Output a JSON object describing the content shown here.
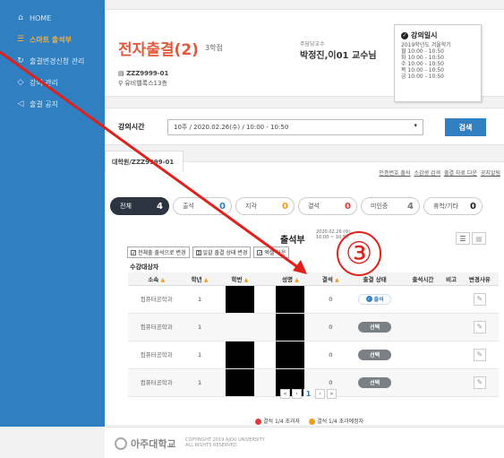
{
  "sidebar": {
    "items": [
      {
        "label": "HOME",
        "icon": "home-icon"
      },
      {
        "label": "스마트 출석부",
        "icon": "list-icon",
        "active": true
      },
      {
        "label": "출결변경신청 관리",
        "icon": "refresh-icon"
      },
      {
        "label": "강의 관리",
        "icon": "book-icon"
      },
      {
        "label": "출결 공지",
        "icon": "speaker-icon"
      }
    ]
  },
  "course": {
    "title": "전자출결(2)",
    "credit": "3학점",
    "code": "ZZZ9999-01",
    "room": "유비벨록스13층",
    "professor_label": "주담당교수",
    "professor_name": "박정진,이01 교수님"
  },
  "schedule": {
    "title": "강의일시",
    "semester": "2019학년도 겨울학기",
    "lines": [
      "월 10:00 - 10:50",
      "화 10:00 - 10:50",
      "수 10:00 - 10:50",
      "목 10:00 - 10:50",
      "금 10:00 - 10:50"
    ]
  },
  "search": {
    "label": "강의시간",
    "selected": "10주 / 2020.02.26(수) / 10:00 - 10:50",
    "button": "검색"
  },
  "attendance": {
    "tab_label": "대학원/ZZZ9999-01",
    "top_links": [
      "인증번호 출석",
      "소감생 검색",
      "출결 자료 다운",
      "공지알림"
    ],
    "pills": [
      {
        "label": "전체",
        "count": "4",
        "style": "dark"
      },
      {
        "label": "출석",
        "count": "0",
        "style": "blue"
      },
      {
        "label": "지각",
        "count": "0",
        "style": "orange"
      },
      {
        "label": "결석",
        "count": "0",
        "style": "red"
      },
      {
        "label": "미인증",
        "count": "4",
        "style": "gray"
      },
      {
        "label": "휴학/기타",
        "count": "0",
        "style": "black"
      }
    ],
    "title": "출석부",
    "date_line1": "2020.02.26 (수)",
    "date_line2": "10:00 ~ 10:50",
    "checks": [
      "전체출 출석으로 변경",
      "일괄 출결 상태 변경",
      "엑셀 다운"
    ],
    "students_label": "수강대상자",
    "columns": [
      "소속",
      "학년",
      "학번",
      "성명",
      "결석",
      "출결 상태",
      "출석시간",
      "비고",
      "변경사유"
    ],
    "rows": [
      {
        "dept": "컴퓨터공학과",
        "year": "1",
        "absent": "0",
        "status": "출석",
        "status_type": "present"
      },
      {
        "dept": "컴퓨터공학과",
        "year": "1",
        "absent": "0",
        "status": "선택",
        "status_type": "select"
      },
      {
        "dept": "컴퓨터공학과",
        "year": "1",
        "absent": "0",
        "status": "선택",
        "status_type": "select"
      },
      {
        "dept": "컴퓨터공학과",
        "year": "1",
        "absent": "0",
        "status": "선택",
        "status_type": "select"
      }
    ],
    "pager": [
      "«",
      "‹",
      "1",
      "›",
      "»"
    ],
    "legend": [
      {
        "text": "결석 1/4 초과자",
        "color": "#e03a3a"
      },
      {
        "text": "결석 1/4 초과예정자",
        "color": "#f19a1a"
      }
    ]
  },
  "footer": {
    "logo": "아주대학교",
    "copyright_line1": "COPYRIGHT 2019 AJOU UNIVERSITY",
    "copyright_line2": "ALL RIGHTS RESERVED."
  },
  "annotation": {
    "number": "③",
    "color": "#e0201b"
  }
}
